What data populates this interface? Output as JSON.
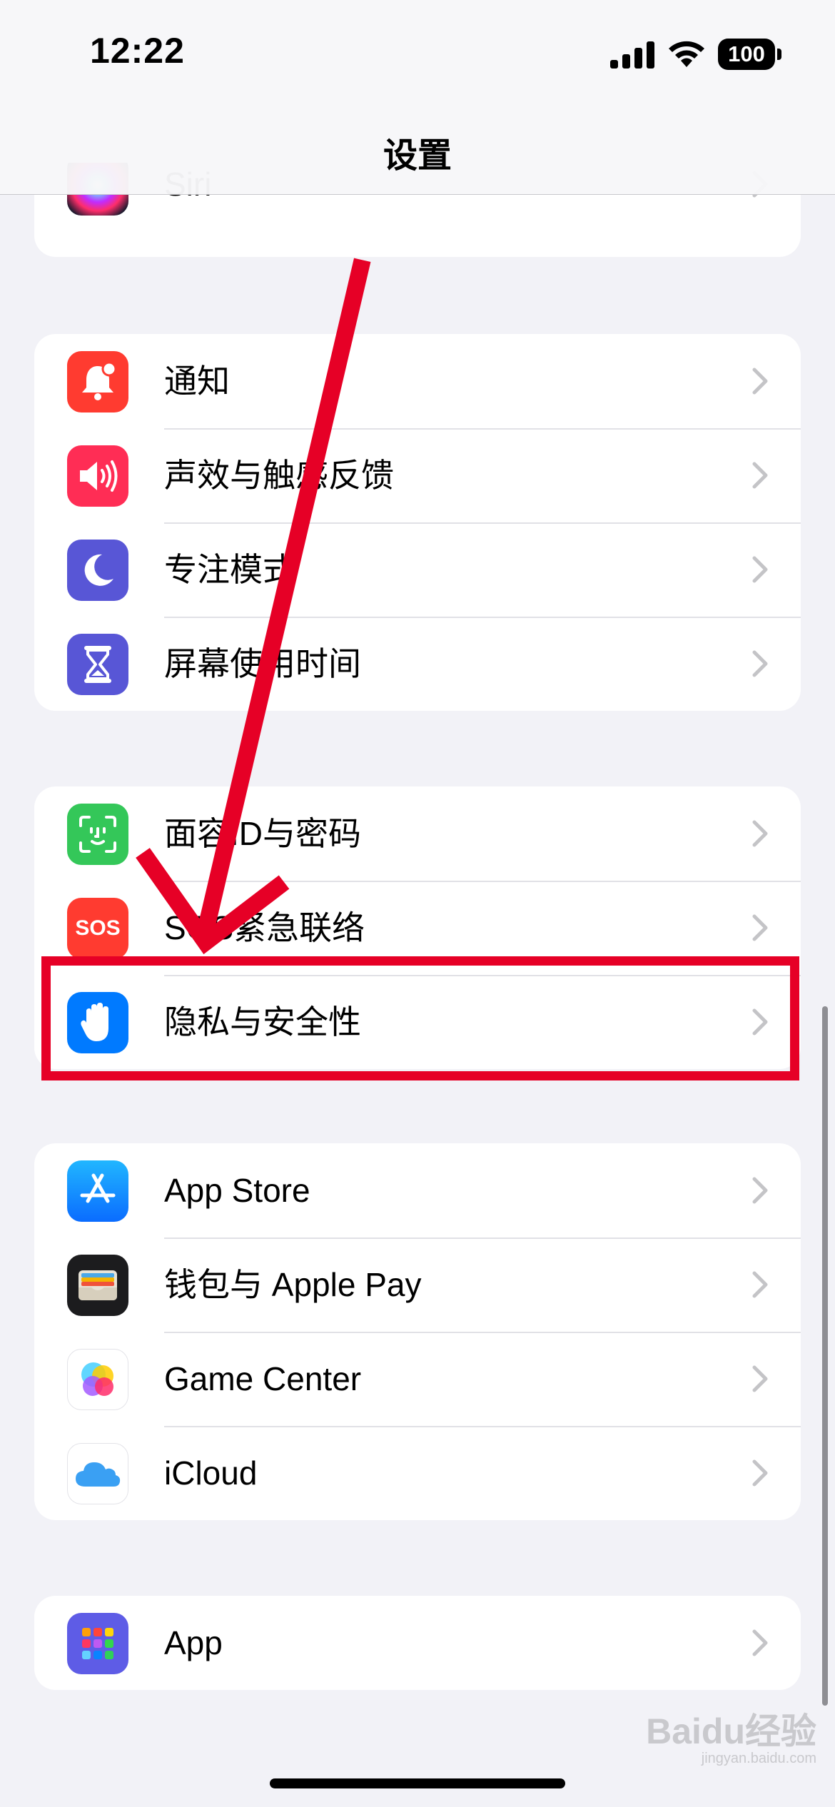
{
  "status_bar": {
    "time": "12:22",
    "battery": "100"
  },
  "nav": {
    "title": "设置"
  },
  "groups": [
    {
      "items": [
        {
          "label": "Siri",
          "icon": "siri-icon"
        }
      ]
    },
    {
      "items": [
        {
          "label": "通知",
          "icon": "bell-icon",
          "color": "#ff3b30"
        },
        {
          "label": "声效与触感反馈",
          "icon": "speaker-icon",
          "color": "#ff2d55"
        },
        {
          "label": "专注模式",
          "icon": "moon-icon",
          "color": "#5856d6"
        },
        {
          "label": "屏幕使用时间",
          "icon": "hourglass-icon",
          "color": "#5856d6"
        }
      ]
    },
    {
      "items": [
        {
          "label": "面容ID与密码",
          "icon": "face-id-icon",
          "color": "#34c759"
        },
        {
          "label": "SOS紧急联络",
          "icon": "sos-icon",
          "color": "#ff3b30",
          "icon_text": "SOS"
        },
        {
          "label": "隐私与安全性",
          "icon": "hand-icon",
          "color": "#007aff"
        }
      ]
    },
    {
      "items": [
        {
          "label": "App Store",
          "icon": "app-store-icon",
          "color": "#0a84ff"
        },
        {
          "label": "钱包与 Apple Pay",
          "icon": "wallet-icon",
          "color": "#1c1c1e"
        },
        {
          "label": "Game Center",
          "icon": "game-center-icon",
          "color": "#ffffff"
        },
        {
          "label": "iCloud",
          "icon": "icloud-icon",
          "color": "#ffffff"
        }
      ]
    },
    {
      "items": [
        {
          "label": "App",
          "icon": "apps-grid-icon",
          "color": "#5e5ce6"
        }
      ]
    }
  ],
  "watermark": {
    "text": "Baidu经验",
    "sub": "jingyan.baidu.com"
  }
}
